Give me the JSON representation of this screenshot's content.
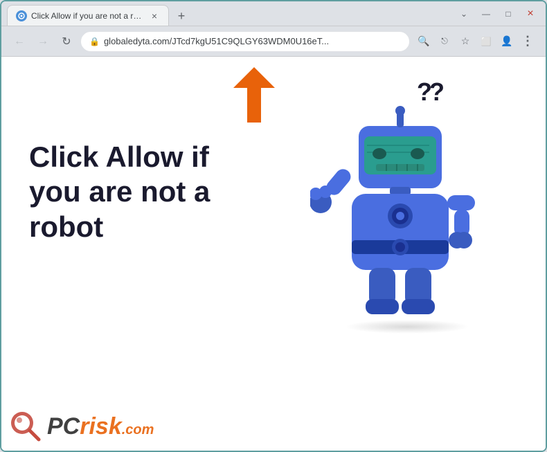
{
  "browser": {
    "tab": {
      "favicon": "●",
      "title": "Click Allow if you are not a robot",
      "close": "×"
    },
    "new_tab": "+",
    "window_controls": {
      "chevron_down": "⌄",
      "minimize": "—",
      "maximize": "□",
      "close": "×"
    },
    "nav": {
      "back": "←",
      "forward": "→",
      "reload": "↻"
    },
    "address": {
      "lock": "🔒",
      "url": "globaledyta.com/JTcd7kgU51C9QLGY63WDM0U16eT...",
      "search_icon": "🔍",
      "share_icon": "⎋",
      "bookmark_icon": "☆",
      "split_icon": "⬜",
      "profile_icon": "👤",
      "menu_icon": "⋮"
    }
  },
  "page": {
    "main_text_line1": "Click Allow if",
    "main_text_line2": "you are not a",
    "main_text_line3": "robot",
    "question_marks": "??",
    "arrow_color": "#e8620a",
    "watermark": {
      "pc": "PC",
      "risk": "risk",
      "com": ".com"
    }
  }
}
